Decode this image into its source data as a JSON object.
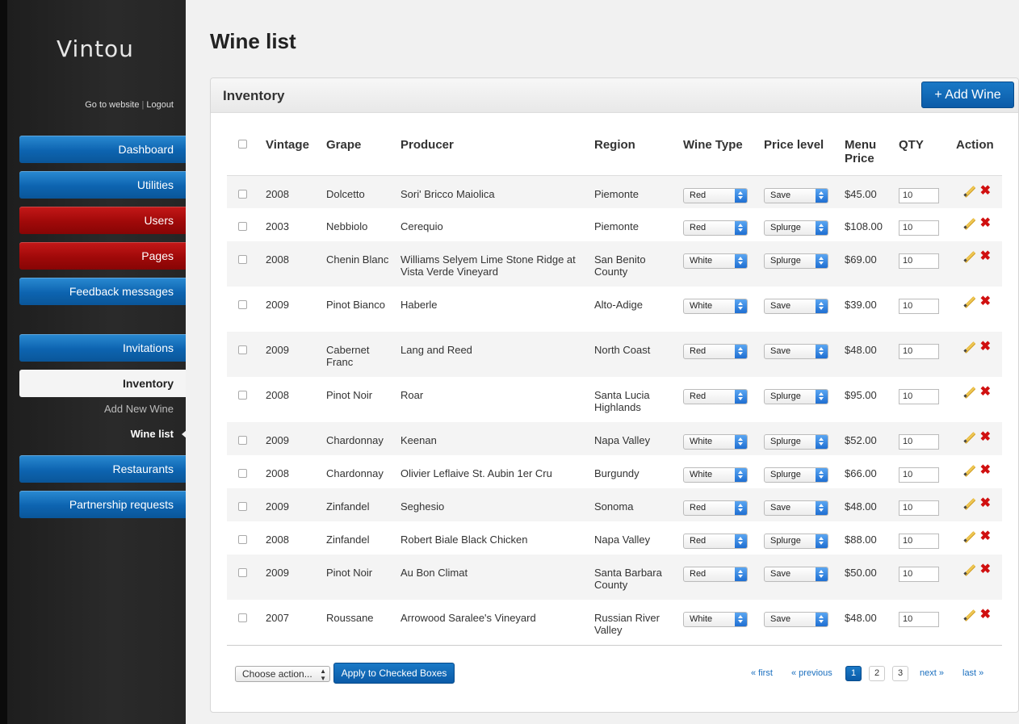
{
  "brand": "Vintou",
  "top_links": {
    "website": "Go to website",
    "separator": "|",
    "logout": "Logout"
  },
  "nav": {
    "dashboard": "Dashboard",
    "utilities": "Utilities",
    "users": "Users",
    "pages": "Pages",
    "feedback": "Feedback messages",
    "invitations": "Invitations",
    "inventory": "Inventory",
    "add_new_wine": "Add New Wine",
    "wine_list": "Wine list",
    "restaurants": "Restaurants",
    "partnership": "Partnership requests"
  },
  "page_title": "Wine list",
  "panel": {
    "title": "Inventory",
    "add_button": "+ Add Wine"
  },
  "columns": {
    "vintage": "Vintage",
    "grape": "Grape",
    "producer": "Producer",
    "region": "Region",
    "wine_type": "Wine Type",
    "price_level": "Price level",
    "menu_price": "Menu Price",
    "qty": "QTY",
    "action": "Action"
  },
  "rows": [
    {
      "vintage": "2008",
      "grape": "Dolcetto",
      "producer": "Sori' Bricco Maiolica",
      "region": "Piemonte",
      "type": "Red",
      "level": "Save",
      "price": "$45.00",
      "qty": "10"
    },
    {
      "vintage": "2003",
      "grape": "Nebbiolo",
      "producer": "Cerequio",
      "region": "Piemonte",
      "type": "Red",
      "level": "Splurge",
      "price": "$108.00",
      "qty": "10"
    },
    {
      "vintage": "2008",
      "grape": "Chenin Blanc",
      "producer": "Williams Selyem Lime Stone Ridge at Vista Verde Vineyard",
      "region": "San Benito County",
      "type": "White",
      "level": "Splurge",
      "price": "$69.00",
      "qty": "10"
    },
    {
      "vintage": "2009",
      "grape": "Pinot Bianco",
      "producer": "Haberle",
      "region": "Alto-Adige",
      "type": "White",
      "level": "Save",
      "price": "$39.00",
      "qty": "10"
    },
    {
      "vintage": "2009",
      "grape": "Cabernet Franc",
      "producer": "Lang and Reed",
      "region": "North Coast",
      "type": "Red",
      "level": "Save",
      "price": "$48.00",
      "qty": "10"
    },
    {
      "vintage": "2008",
      "grape": "Pinot Noir",
      "producer": "Roar",
      "region": "Santa Lucia Highlands",
      "type": "Red",
      "level": "Splurge",
      "price": "$95.00",
      "qty": "10"
    },
    {
      "vintage": "2009",
      "grape": "Chardonnay",
      "producer": "Keenan",
      "region": "Napa Valley",
      "type": "White",
      "level": "Splurge",
      "price": "$52.00",
      "qty": "10"
    },
    {
      "vintage": "2008",
      "grape": "Chardonnay",
      "producer": "Olivier Leflaive St. Aubin 1er Cru",
      "region": "Burgundy",
      "type": "White",
      "level": "Splurge",
      "price": "$66.00",
      "qty": "10"
    },
    {
      "vintage": "2009",
      "grape": "Zinfandel",
      "producer": "Seghesio",
      "region": "Sonoma",
      "type": "Red",
      "level": "Save",
      "price": "$48.00",
      "qty": "10"
    },
    {
      "vintage": "2008",
      "grape": "Zinfandel",
      "producer": "Robert Biale Black Chicken",
      "region": "Napa Valley",
      "type": "Red",
      "level": "Splurge",
      "price": "$88.00",
      "qty": "10"
    },
    {
      "vintage": "2009",
      "grape": "Pinot Noir",
      "producer": "Au Bon Climat",
      "region": "Santa Barbara County",
      "type": "Red",
      "level": "Save",
      "price": "$50.00",
      "qty": "10"
    },
    {
      "vintage": "2007",
      "grape": "Roussane",
      "producer": "Arrowood Saralee's Vineyard",
      "region": "Russian River Valley",
      "type": "White",
      "level": "Save",
      "price": "$48.00",
      "qty": "10"
    }
  ],
  "footer": {
    "choose_action": "Choose action...",
    "apply": "Apply to Checked Boxes",
    "first": "« first",
    "previous": "« previous",
    "pages": [
      "1",
      "2",
      "3"
    ],
    "current_page": "1",
    "next": "next »",
    "last": "last »"
  },
  "icons": {
    "edit": "pencil-icon",
    "delete": "delete-x-icon"
  },
  "colors": {
    "nav_blue": "#0d64b0",
    "nav_red": "#a00909",
    "button_blue": "#0b5ba8",
    "link_blue": "#1a6fbf"
  }
}
